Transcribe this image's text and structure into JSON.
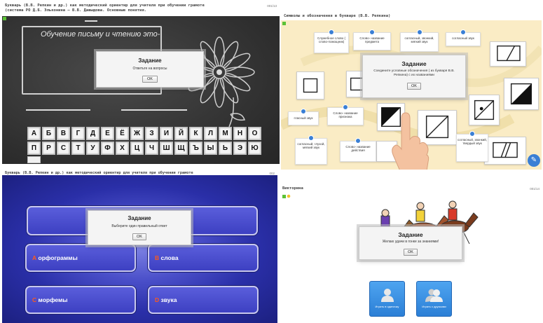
{
  "panel1": {
    "title_line1": "Букварь (В.В. Репкин и др.) как методический ориентир для учителя при обучении грамоте",
    "title_line2": "(система РО Д.Б. Эльконина – В.В. Давыдова. Основные понятия.",
    "number": "001/13",
    "board_text": "Обучение письму и чтению это-",
    "dialog": {
      "title": "Задание",
      "message": "Ответьте на вопросы",
      "ok": "OK"
    },
    "keys_row1": [
      "А",
      "Б",
      "В",
      "Г",
      "Д",
      "Е",
      "Ё",
      "Ж",
      "З",
      "И",
      "Й",
      "К",
      "Л",
      "М",
      "Н",
      "О"
    ],
    "keys_row2": [
      "П",
      "Р",
      "С",
      "Т",
      "У",
      "Ф",
      "Х",
      "Ц",
      "Ч",
      "Ш",
      "Щ",
      "Ъ",
      "Ы",
      "Ь",
      "Э",
      "Ю"
    ],
    "key_colors": {
      "board": "#2f2f2f",
      "key": "#f4f4f4"
    }
  },
  "panel2": {
    "title": "Символы и обозначения в букваре (В.В. Репкина)",
    "dialog": {
      "title": "Задание",
      "message": "Соедините условные обозначения ( из букваря В.В. Репкина) с их названиями",
      "ok": "OK"
    },
    "cards": [
      "Служебное слово ( слово-помощник)",
      "Слово- название предмета",
      "согласный, звонкий, мягкий звук",
      "согласный звук",
      "гласный звук",
      "Слово- название признака",
      "согласный, глухой, мягкий звук",
      "Слово- название действия",
      "согласный, звонкий, твердый звук"
    ],
    "accent": "#3a7fd5"
  },
  "panel3": {
    "title": "Букварь (В.В. Репкин и др.) как методический ориентир для учителя при обучении грамоте",
    "number": "002",
    "dialog": {
      "title": "Задание",
      "message": "Выберите один правильный ответ",
      "ok": "OK"
    },
    "answers": [
      {
        "letter": "A",
        "text": "орфограммы"
      },
      {
        "letter": "B",
        "text": "слова"
      },
      {
        "letter": "C",
        "text": "морфемы"
      },
      {
        "letter": "D",
        "text": "звука"
      }
    ],
    "letter_color": "#ff5a1a"
  },
  "panel4": {
    "title": "Викторина",
    "number": "001/14",
    "dialog": {
      "title": "Задание",
      "message": "Желаю удачи в гонке за знаниями!",
      "ok": "OK"
    },
    "buttons": [
      {
        "label": "Играть в одиночку",
        "icon": "single-player-icon"
      },
      {
        "label": "Играть с друзьями",
        "icon": "multi-player-icon"
      }
    ]
  }
}
